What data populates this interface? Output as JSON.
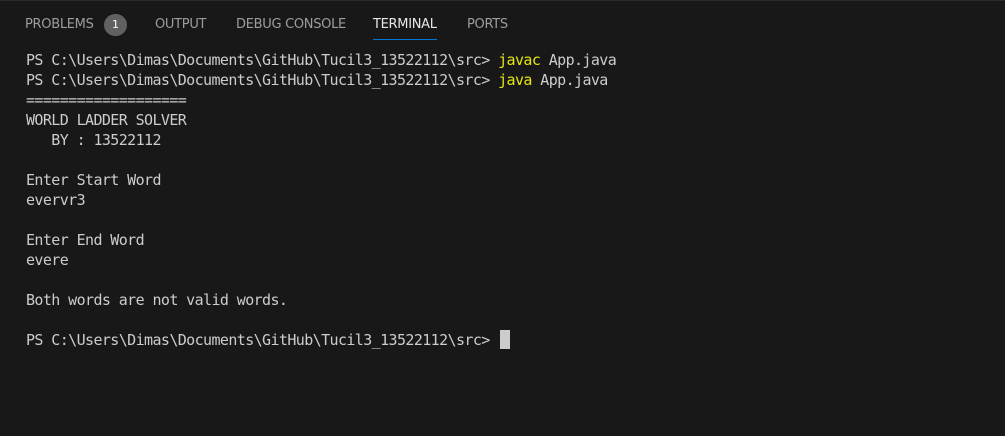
{
  "tabs": {
    "problems": "PROBLEMS",
    "problems_count": "1",
    "output": "OUTPUT",
    "debug_console": "DEBUG CONSOLE",
    "terminal": "TERMINAL",
    "ports": "PORTS"
  },
  "terminal": {
    "prompt": "PS C:\\Users\\Dimas\\Documents\\GitHub\\Tucil3_13522112\\src> ",
    "cmd1": "javac",
    "cmd1_arg": " App.java",
    "cmd2": "java",
    "cmd2_arg": " App.java",
    "separator": "===================",
    "title": "WORLD LADDER SOLVER",
    "byline": "   BY : 13522112",
    "start_prompt": "Enter Start Word",
    "start_input": "evervr3",
    "end_prompt": "Enter End Word",
    "end_input": "evere",
    "result": "Both words are not valid words."
  },
  "colors": {
    "background": "#181818",
    "text": "#cccccc",
    "command": "#e5e510",
    "active_tab_underline": "#0078d4",
    "badge": "#616161"
  }
}
